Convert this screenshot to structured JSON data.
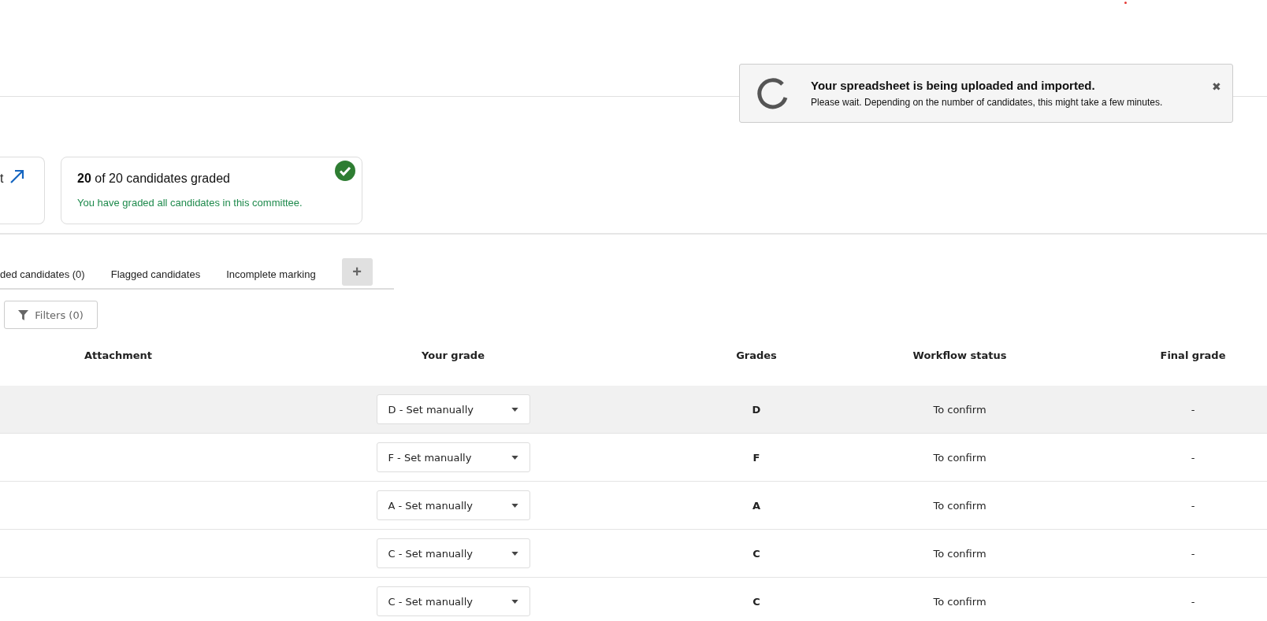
{
  "toast": {
    "title": "Your spreadsheet is being uploaded and imported.",
    "message": "Please wait. Depending on the number of candidates, this might take a few minutes.",
    "close": "✖"
  },
  "cards": [
    {
      "kind": "link",
      "title": "t"
    },
    {
      "kind": "status",
      "title": "**20** of 20 candidates graded",
      "message": "You have graded all candidates in this committee."
    }
  ],
  "tabs": [
    {
      "label": "ded candidates (0)"
    },
    {
      "label": "Flagged candidates"
    },
    {
      "label": "Incomplete marking"
    }
  ],
  "add_tab": "+",
  "filters": "Filters (0)",
  "table": {
    "columns": [
      "Attachment",
      "Your grade",
      "Grades",
      "Workflow status",
      "Final grade"
    ],
    "rows": [
      {
        "selected": true,
        "your_grade": "D - Set manually",
        "grades": "D",
        "workflow_status": "To confirm",
        "final_grade": "-"
      },
      {
        "selected": false,
        "your_grade": "F - Set manually",
        "grades": "F",
        "workflow_status": "To confirm",
        "final_grade": "-"
      },
      {
        "selected": false,
        "your_grade": "A - Set manually",
        "grades": "A",
        "workflow_status": "To confirm",
        "final_grade": "-"
      },
      {
        "selected": false,
        "your_grade": "C - Set manually",
        "grades": "C",
        "workflow_status": "To confirm",
        "final_grade": "-"
      },
      {
        "selected": false,
        "your_grade": "C - Set manually",
        "grades": "C",
        "workflow_status": "To confirm",
        "final_grade": "-"
      }
    ]
  }
}
